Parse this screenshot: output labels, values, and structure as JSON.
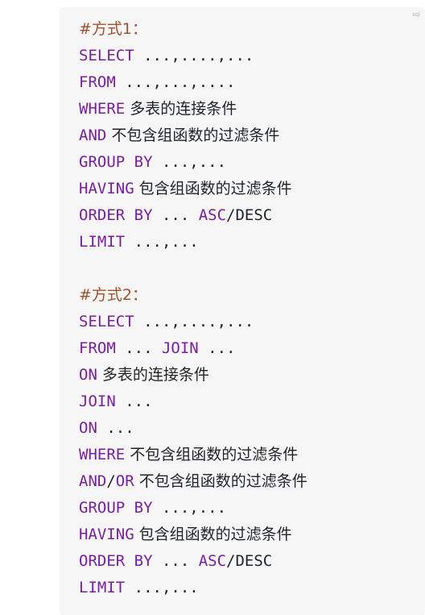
{
  "code_block": {
    "language_label": "sql",
    "lines": [
      {
        "comment": "#方式1："
      },
      {
        "keyword": "SELECT",
        "text": " ...,....,..."
      },
      {
        "keyword": "FROM",
        "text": " ...,...,...."
      },
      {
        "keyword": "WHERE",
        "text": " 多表的连接条件"
      },
      {
        "keyword": "AND",
        "text": " 不包含组函数的过滤条件"
      },
      {
        "keyword": "GROUP BY",
        "text": " ...,..."
      },
      {
        "keyword": "HAVING",
        "text": " 包含组函数的过滤条件"
      },
      {
        "keyword": "ORDER BY",
        "text": " ... ",
        "keyword2": "ASC",
        "text2": "/DESC"
      },
      {
        "keyword": "LIMIT",
        "text": " ...,..."
      },
      {
        "blank": true
      },
      {
        "comment": "#方式2："
      },
      {
        "keyword": "SELECT",
        "text": " ...,....,..."
      },
      {
        "keyword": "FROM",
        "text": " ... ",
        "keyword2": "JOIN",
        "text2": " ..."
      },
      {
        "keyword": "ON",
        "text": " 多表的连接条件"
      },
      {
        "keyword": "JOIN",
        "text": " ..."
      },
      {
        "keyword": "ON",
        "text": " ..."
      },
      {
        "keyword": "WHERE",
        "text": " 不包含组函数的过滤条件"
      },
      {
        "keyword": "AND",
        "text": "/",
        "keyword2": "OR",
        "text2": " 不包含组函数的过滤条件"
      },
      {
        "keyword": "GROUP BY",
        "text": " ...,..."
      },
      {
        "keyword": "HAVING",
        "text": " 包含组函数的过滤条件"
      },
      {
        "keyword": "ORDER BY",
        "text": " ... ",
        "keyword2": "ASC",
        "text2": "/DESC"
      },
      {
        "keyword": "LIMIT",
        "text": " ...,..."
      }
    ]
  },
  "colors": {
    "keyword": "#7a1f9c",
    "comment": "#a0522d",
    "text": "#1f2328",
    "background": "#f6f6f7"
  }
}
